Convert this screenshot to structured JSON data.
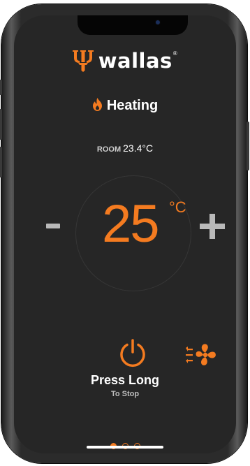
{
  "brand": {
    "name": "wallas",
    "registered_mark": "®",
    "accent_color": "#f47b20",
    "logo_icon": "trident-icon"
  },
  "mode": {
    "label": "Heating",
    "icon": "flame-icon"
  },
  "room": {
    "label": "ROOM",
    "value": "23.4°C"
  },
  "setpoint": {
    "value": "25",
    "unit": "°C"
  },
  "controls": {
    "decrease_icon": "minus-icon",
    "increase_icon": "plus-icon",
    "power_icon": "power-icon",
    "fan_icon": "fan-icon"
  },
  "power": {
    "hint_title": "Press Long",
    "hint_subtitle": "To Stop"
  },
  "pager": {
    "page_count": 3,
    "active_index": 0
  },
  "colors": {
    "background": "#262626",
    "text": "#ffffff",
    "muted_button": "#b9b9b9"
  }
}
